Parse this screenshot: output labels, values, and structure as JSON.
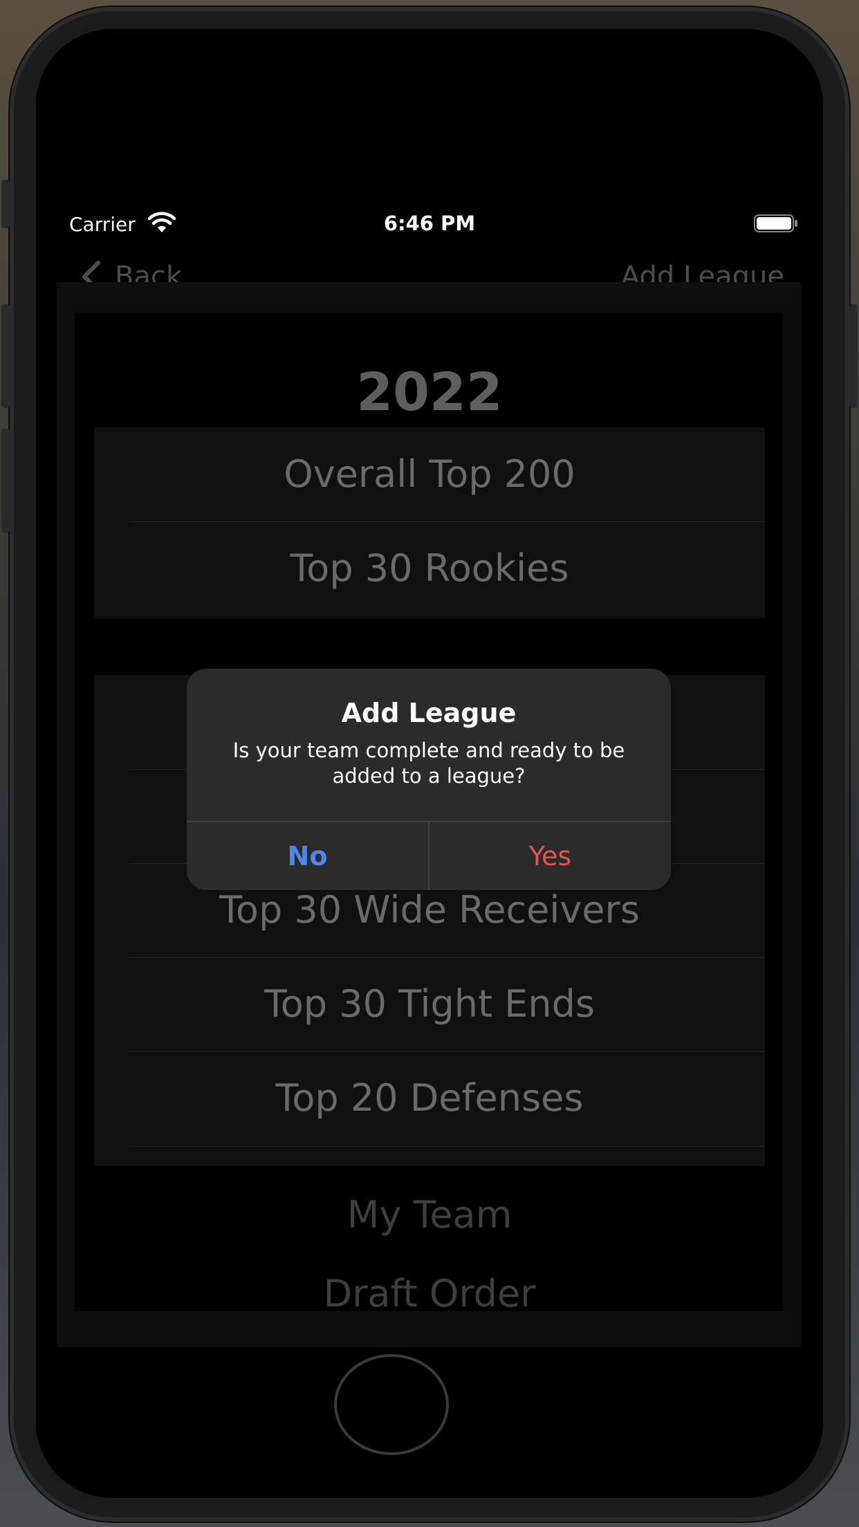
{
  "status_bar": {
    "carrier": "Carrier",
    "time": "6:46 PM"
  },
  "nav": {
    "back_label": "Back",
    "add_league_label": "Add League"
  },
  "content": {
    "year": "2022",
    "group1": [
      "Overall Top 200",
      "Top 30 Rookies"
    ],
    "group2": [
      "",
      "",
      "Top 30 Wide Receivers",
      "Top 30 Tight Ends",
      "Top 20 Defenses"
    ],
    "footer": [
      "My Team",
      "Draft Order"
    ]
  },
  "alert": {
    "title": "Add League",
    "message": "Is your team complete and ready to be added to a league?",
    "no_label": "No",
    "yes_label": "Yes"
  },
  "colors": {
    "alert_no": "#4f86ec",
    "alert_yes": "#e4554d",
    "alert_background": "#2b2b2b",
    "screen_background": "#000000"
  },
  "icons": [
    "wifi-icon",
    "battery-icon",
    "chevron-left-icon"
  ]
}
